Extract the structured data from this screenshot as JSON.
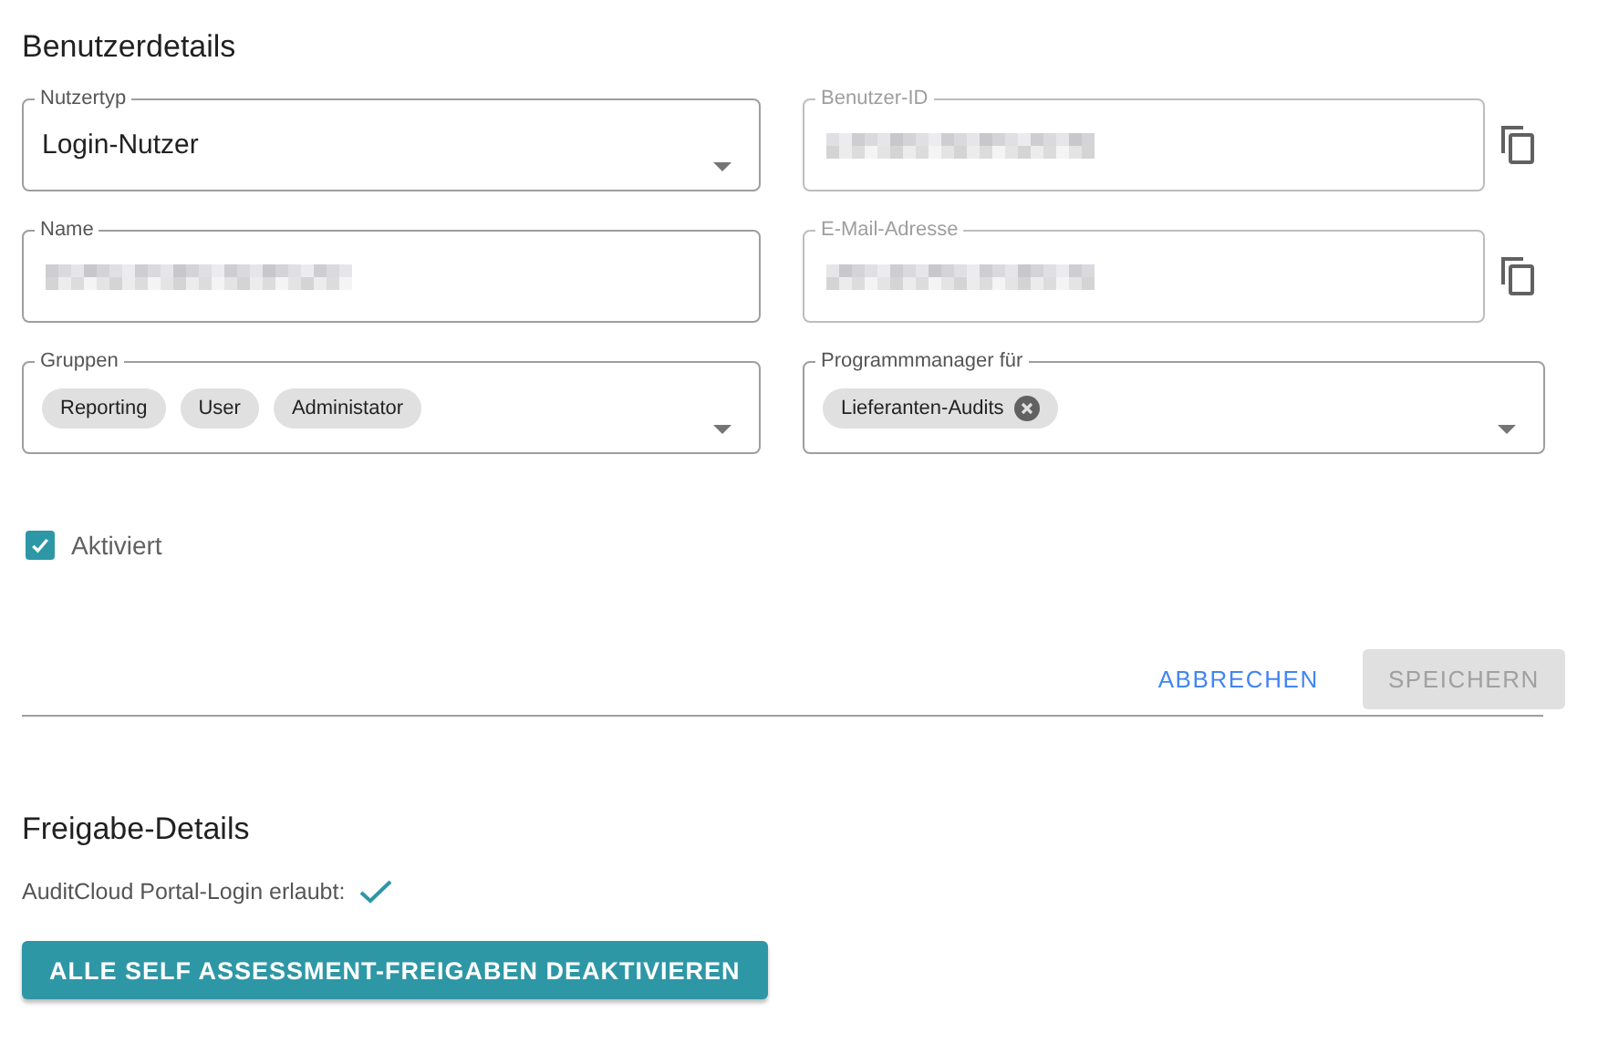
{
  "section_title": "Benutzerdetails",
  "fields": [
    {
      "kind": "select",
      "label": "Nutzertyp",
      "value": "Login-Nutzer",
      "disabled": false
    },
    {
      "kind": "text",
      "label": "Benutzer-ID",
      "redacted": true,
      "disabled": true,
      "copyable": true
    },
    {
      "kind": "text",
      "label": "Name",
      "redacted": true,
      "disabled": false
    },
    {
      "kind": "text",
      "label": "E-Mail-Adresse",
      "redacted": true,
      "disabled": true,
      "copyable": true
    },
    {
      "kind": "chips",
      "label": "Gruppen",
      "disabled": false,
      "chips": [
        {
          "label": "Reporting",
          "removable": false
        },
        {
          "label": "User",
          "removable": false
        },
        {
          "label": "Administator",
          "removable": false
        }
      ]
    },
    {
      "kind": "chips",
      "label": "Programmmanager für",
      "disabled": false,
      "chips": [
        {
          "label": "Lieferanten-Audits",
          "removable": true
        }
      ]
    }
  ],
  "active_checkbox": {
    "label": "Aktiviert",
    "checked": true
  },
  "actions": [
    {
      "label": "ABBRECHEN",
      "disabled": false
    },
    {
      "label": "SPEICHERN",
      "disabled": true
    }
  ],
  "release_title": "Freigabe-Details",
  "portal_login": {
    "label": "AuditCloud Portal-Login erlaubt:",
    "allowed": true
  },
  "deactivate_button": "ALLE SELF ASSESSMENT-FREIGABEN DEAKTIVIEREN"
}
